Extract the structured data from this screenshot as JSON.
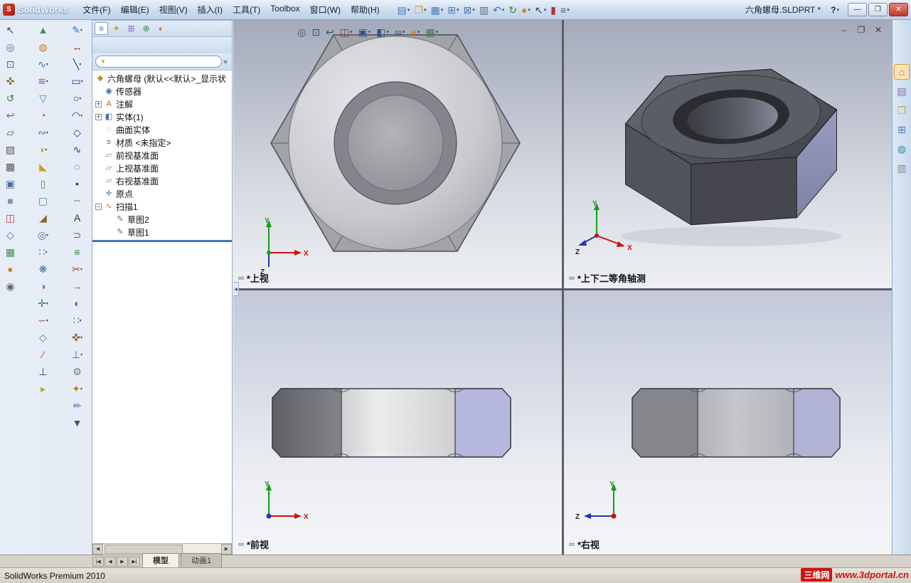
{
  "window": {
    "app_name": "SolidWorks",
    "doc_title": "六角螺母.SLDPRT *",
    "help_label": "?",
    "controls": {
      "minimize": "—",
      "maximize": "❐",
      "close": "✕"
    },
    "doc_controls": {
      "minimize": "–",
      "restore": "❐",
      "close": "✕"
    }
  },
  "menubar": {
    "items": [
      {
        "name": "menu-file",
        "label": "文件(F)"
      },
      {
        "name": "menu-edit",
        "label": "编辑(E)"
      },
      {
        "name": "menu-view",
        "label": "视图(V)"
      },
      {
        "name": "menu-insert",
        "label": "插入(I)"
      },
      {
        "name": "menu-tools",
        "label": "工具(T)"
      },
      {
        "name": "menu-toolbox",
        "label": "Toolbox"
      },
      {
        "name": "menu-window",
        "label": "窗口(W)"
      },
      {
        "name": "menu-help",
        "label": "帮助(H)"
      }
    ]
  },
  "titlebar_tools": [
    {
      "name": "new-file-icon",
      "glyph": "▤",
      "color": "#4a78b8",
      "caret": true
    },
    {
      "name": "open-file-icon",
      "glyph": "❐",
      "color": "#c9a232",
      "caret": true
    },
    {
      "name": "save-icon",
      "glyph": "▦",
      "color": "#4a78b8",
      "caret": true
    },
    {
      "name": "make-drawing-icon",
      "glyph": "⊞",
      "color": "#4a78b8",
      "caret": true
    },
    {
      "name": "make-assembly-icon",
      "glyph": "⊠",
      "color": "#4a78b8",
      "caret": true
    },
    {
      "name": "print-icon",
      "glyph": "▥",
      "color": "#5a6a7a",
      "caret": false
    },
    {
      "name": "undo-icon",
      "glyph": "↶",
      "color": "#3a6fc4",
      "caret": true
    },
    {
      "name": "rebuild-icon",
      "glyph": "↻",
      "color": "#3a8a3a",
      "caret": false
    },
    {
      "name": "edit-appearance-icon",
      "glyph": "●",
      "color": "#cc8833",
      "caret": true
    },
    {
      "name": "select-cursor-icon",
      "glyph": "↖",
      "color": "#39414f",
      "caret": true
    },
    {
      "name": "toolbox-icon",
      "glyph": "▮",
      "color": "#b03030",
      "caret": false
    },
    {
      "name": "command-manager-icon",
      "glyph": "≡",
      "color": "#44608a",
      "caret": true
    }
  ],
  "headsup_tools": [
    {
      "name": "zoom-fit-icon",
      "glyph": "◎",
      "color": "#33527d",
      "caret": false
    },
    {
      "name": "zoom-area-icon",
      "glyph": "⊡",
      "color": "#33527d",
      "caret": false
    },
    {
      "name": "previous-view-icon",
      "glyph": "↩",
      "color": "#33527d",
      "caret": false
    },
    {
      "name": "section-view-icon",
      "glyph": "◫",
      "color": "#7a3a3a",
      "caret": true
    },
    {
      "name": "view-orientation-icon",
      "glyph": "▣",
      "color": "#33527d",
      "caret": true
    },
    {
      "name": "display-style-icon",
      "glyph": "◧",
      "color": "#33527d",
      "caret": true
    },
    {
      "name": "hide-show-items-icon",
      "glyph": "∞",
      "color": "#33527d",
      "caret": true
    },
    {
      "name": "edit-appearance-icon",
      "glyph": "●",
      "color": "#cc8833",
      "caret": true
    },
    {
      "name": "apply-scene-icon",
      "glyph": "▦",
      "color": "#3a7a4a",
      "caret": true
    }
  ],
  "left_toolbar_view": [
    {
      "name": "select-icon",
      "glyph": "↖",
      "color": "#39414f",
      "caret": false
    },
    {
      "name": "zoom-fit-icon",
      "glyph": "◎",
      "color": "#4a6fa0",
      "caret": false
    },
    {
      "name": "zoom-area-icon",
      "glyph": "⊡",
      "color": "#4a6fa0",
      "caret": false
    },
    {
      "name": "pan-icon",
      "glyph": "✜",
      "color": "#8a6a2a",
      "caret": false
    },
    {
      "name": "rotate-view-icon",
      "glyph": "↺",
      "color": "#3a7a3a",
      "caret": false
    },
    {
      "name": "previous-view-icon",
      "glyph": "↩",
      "color": "#4a6fa0",
      "caret": false
    },
    {
      "name": "wireframe-icon",
      "glyph": "▱",
      "color": "#5a5a62",
      "caret": false
    },
    {
      "name": "hidden-lines-visible-icon",
      "glyph": "▨",
      "color": "#5a5a62",
      "caret": false
    },
    {
      "name": "hidden-lines-removed-icon",
      "glyph": "▩",
      "color": "#5a5a62",
      "caret": false
    },
    {
      "name": "shaded-with-edges-icon",
      "glyph": "▣",
      "color": "#4a6fa0",
      "caret": false
    },
    {
      "name": "shaded-icon",
      "glyph": "■",
      "color": "#7d93b8",
      "caret": false
    },
    {
      "name": "section-view-icon",
      "glyph": "◫",
      "color": "#a04a4a",
      "caret": false
    },
    {
      "name": "view-orientation-icon",
      "glyph": "◇",
      "color": "#4a6fa0",
      "caret": false
    },
    {
      "name": "apply-scene-icon",
      "glyph": "▦",
      "color": "#4a8a4a",
      "caret": false
    },
    {
      "name": "edit-appearance-icon",
      "glyph": "●",
      "color": "#d08030",
      "caret": false
    },
    {
      "name": "camera-views-icon",
      "glyph": "◉",
      "color": "#666666",
      "caret": false
    }
  ],
  "left_toolbar_features": [
    {
      "name": "extruded-boss-icon",
      "glyph": "▲",
      "color": "#3f8f3f",
      "caret": false
    },
    {
      "name": "revolved-boss-icon",
      "glyph": "◍",
      "color": "#cc7a22",
      "caret": false
    },
    {
      "name": "swept-boss-icon",
      "glyph": "∿",
      "color": "#3a6fc0",
      "caret": true
    },
    {
      "name": "lofted-boss-icon",
      "glyph": "≋",
      "color": "#7a4ac0",
      "caret": true
    },
    {
      "name": "extruded-cut-icon",
      "glyph": "▽",
      "color": "#3f8fa0",
      "caret": false
    },
    {
      "name": "revolved-cut-icon",
      "glyph": "◔",
      "color": "#c05a2a",
      "caret": false
    },
    {
      "name": "swept-cut-icon",
      "glyph": "∾",
      "color": "#5a6a9a",
      "caret": true
    },
    {
      "name": "fillet-icon",
      "glyph": "◖",
      "color": "#d0a020",
      "caret": true
    },
    {
      "name": "chamfer-icon",
      "glyph": "◣",
      "color": "#d0a020",
      "caret": false
    },
    {
      "name": "rib-icon",
      "glyph": "▯",
      "color": "#6a8a4a",
      "caret": false
    },
    {
      "name": "shell-icon",
      "glyph": "▢",
      "color": "#4a8a8a",
      "caret": false
    },
    {
      "name": "draft-icon",
      "glyph": "◢",
      "color": "#8a6a3a",
      "caret": false
    },
    {
      "name": "hole-wizard-icon",
      "glyph": "◎",
      "color": "#4a6fa0",
      "caret": true
    },
    {
      "name": "linear-pattern-icon",
      "glyph": "∷",
      "color": "#3f6f9f",
      "caret": true
    },
    {
      "name": "circular-pattern-icon",
      "glyph": "❋",
      "color": "#3f6f9f",
      "caret": false
    },
    {
      "name": "mirror-icon",
      "glyph": "◑",
      "color": "#6f6fae",
      "caret": false
    },
    {
      "name": "reference-geometry-icon",
      "glyph": "✛",
      "color": "#2f7f5f",
      "caret": true
    },
    {
      "name": "curves-icon",
      "glyph": "∽",
      "color": "#9f4f7f",
      "caret": true
    },
    {
      "name": "plane-icon",
      "glyph": "◇",
      "color": "#5a7aa0",
      "caret": false
    },
    {
      "name": "axis-icon",
      "glyph": "⁄",
      "color": "#cc3333",
      "caret": false
    },
    {
      "name": "coordinate-system-icon",
      "glyph": "⊥",
      "color": "#3a3a8a",
      "caret": false
    },
    {
      "name": "instant3d-icon",
      "glyph": "▸",
      "color": "#caa020",
      "caret": false
    }
  ],
  "left_toolbar_sketch": [
    {
      "name": "sketch-icon",
      "glyph": "✎",
      "color": "#3a6fc0",
      "caret": true
    },
    {
      "name": "smart-dimension-icon",
      "glyph": "↔",
      "color": "#8a2a2a",
      "caret": false
    },
    {
      "name": "line-icon",
      "glyph": "╲",
      "color": "#2a2a8a",
      "caret": true
    },
    {
      "name": "rectangle-icon",
      "glyph": "▭",
      "color": "#2a2a8a",
      "caret": true
    },
    {
      "name": "circle-icon",
      "glyph": "○",
      "color": "#2a2a8a",
      "caret": true
    },
    {
      "name": "arc-icon",
      "glyph": "◠",
      "color": "#2a2a8a",
      "caret": true
    },
    {
      "name": "polygon-icon",
      "glyph": "◇",
      "color": "#2a2a8a",
      "caret": false
    },
    {
      "name": "spline-icon",
      "glyph": "∿",
      "color": "#2a2a8a",
      "caret": false
    },
    {
      "name": "ellipse-icon",
      "glyph": "◌",
      "color": "#2a2a8a",
      "caret": false
    },
    {
      "name": "point-icon",
      "glyph": "•",
      "color": "#2a2a8a",
      "caret": false
    },
    {
      "name": "centerline-icon",
      "glyph": "┄",
      "color": "#555577",
      "caret": false
    },
    {
      "name": "text-icon",
      "glyph": "A",
      "color": "#333333",
      "caret": false
    },
    {
      "name": "convert-entities-icon",
      "glyph": "⊃",
      "color": "#3a7a3a",
      "caret": false
    },
    {
      "name": "offset-entities-icon",
      "glyph": "≡",
      "color": "#3a7a3a",
      "caret": false
    },
    {
      "name": "trim-entities-icon",
      "glyph": "✂",
      "color": "#8a4a2a",
      "caret": true
    },
    {
      "name": "extend-entities-icon",
      "glyph": "→",
      "color": "#8a4a2a",
      "caret": false
    },
    {
      "name": "mirror-entities-icon",
      "glyph": "◐",
      "color": "#5a5aa0",
      "caret": false
    },
    {
      "name": "linear-sketch-pattern-icon",
      "glyph": "∷",
      "color": "#3f6f9f",
      "caret": true
    },
    {
      "name": "move-entities-icon",
      "glyph": "✜",
      "color": "#7a5a2a",
      "caret": true
    },
    {
      "name": "display-relations-icon",
      "glyph": "⊥",
      "color": "#3a6fa0",
      "caret": true
    },
    {
      "name": "repair-sketch-icon",
      "glyph": "⚙",
      "color": "#777777",
      "caret": false
    },
    {
      "name": "quick-snaps-icon",
      "glyph": "✦",
      "color": "#b08020",
      "caret": true
    },
    {
      "name": "rapid-sketch-icon",
      "glyph": "✏",
      "color": "#4a6fa0",
      "caret": false
    },
    {
      "name": "toolbar-overflow-icon",
      "glyph": "▼",
      "color": "#445566",
      "caret": false
    }
  ],
  "feature_panel": {
    "tabs": [
      {
        "name": "featuremanager-tab-icon",
        "glyph": "≡",
        "color": "#3a6fc0",
        "active": true
      },
      {
        "name": "propertymanager-tab-icon",
        "glyph": "✦",
        "color": "#caa020",
        "active": false
      },
      {
        "name": "configurationmanager-tab-icon",
        "glyph": "⊞",
        "color": "#8a6ab0",
        "active": false
      },
      {
        "name": "dimxpertmanager-tab-icon",
        "glyph": "⊕",
        "color": "#3a8a5a",
        "active": false
      },
      {
        "name": "displaymanager-tab-icon",
        "glyph": "◐",
        "color": "#b06a3a",
        "active": false
      }
    ],
    "overflow_label": "»",
    "filter_glyph": "▼",
    "root": {
      "glyph": "◆",
      "label": "六角螺母 (默认<<默认>_显示状"
    },
    "tree": [
      {
        "name": "tree-item-sensors",
        "glyph": "◉",
        "color": "#3a6fa0",
        "label": "传感器",
        "expand": ""
      },
      {
        "name": "tree-item-annotations",
        "glyph": "A",
        "color": "#b06a2a",
        "label": "注解",
        "expand": "+"
      },
      {
        "name": "tree-item-solid-bodies",
        "glyph": "◧",
        "color": "#3a6fc0",
        "label": "实体(1)",
        "expand": "+"
      },
      {
        "name": "tree-item-surface-bodies",
        "glyph": "◌",
        "color": "#3a8a8a",
        "label": "曲面实体",
        "expand": ""
      },
      {
        "name": "tree-item-material",
        "glyph": "≡",
        "color": "#666677",
        "label": "材质 <未指定>",
        "expand": ""
      },
      {
        "name": "tree-item-front-plane",
        "glyph": "▱",
        "color": "#7a8aa0",
        "label": "前视基准面",
        "expand": ""
      },
      {
        "name": "tree-item-top-plane",
        "glyph": "▱",
        "color": "#7a8aa0",
        "label": "上视基准面",
        "expand": ""
      },
      {
        "name": "tree-item-right-plane",
        "glyph": "▱",
        "color": "#7a8aa0",
        "label": "右视基准面",
        "expand": ""
      },
      {
        "name": "tree-item-origin",
        "glyph": "✛",
        "color": "#3a6fa0",
        "label": "原点",
        "expand": ""
      },
      {
        "name": "tree-item-sweep1",
        "glyph": "∿",
        "color": "#cc7a22",
        "label": "扫描1",
        "expand": "−"
      },
      {
        "name": "tree-item-sketch2",
        "glyph": "✎",
        "color": "#4a6fa0",
        "label": "草图2",
        "expand": "",
        "indent": 1
      },
      {
        "name": "tree-item-sketch1",
        "glyph": "✎",
        "color": "#4a6fa0",
        "label": "草图1",
        "expand": "",
        "indent": 1
      }
    ]
  },
  "viewports": {
    "eye_glyph": "∞",
    "top_left": {
      "label": "*上视"
    },
    "top_right": {
      "label": "*上下二等角轴测"
    },
    "bottom_left": {
      "label": "*前视"
    },
    "bottom_right": {
      "label": "*右视"
    }
  },
  "graphics": {
    "collapse_glyph": "◀"
  },
  "task_pane": [
    {
      "name": "solidworks-resources-icon",
      "glyph": "⌂",
      "color": "#cc6a2a",
      "active": true
    },
    {
      "name": "design-library-icon",
      "glyph": "▤",
      "color": "#8a6ab0",
      "active": false
    },
    {
      "name": "file-explorer-icon",
      "glyph": "❐",
      "color": "#caa030",
      "active": false
    },
    {
      "name": "view-palette-icon",
      "glyph": "⊞",
      "color": "#4a78b8",
      "active": false
    },
    {
      "name": "appearances-scenes-icon",
      "glyph": "◍",
      "color": "#3a8aa0",
      "active": false
    },
    {
      "name": "custom-properties-icon",
      "glyph": "▥",
      "color": "#888888",
      "active": false
    }
  ],
  "bottom": {
    "tab_nav": [
      {
        "name": "first-tab-button",
        "glyph": "|◀"
      },
      {
        "name": "prev-tab-button",
        "glyph": "◀"
      },
      {
        "name": "next-tab-button",
        "glyph": "▶"
      },
      {
        "name": "last-tab-button",
        "glyph": "▶|"
      }
    ],
    "tabs": [
      {
        "name": "tab-model",
        "label": "模型",
        "active": true
      },
      {
        "name": "tab-animation1",
        "label": "动画1",
        "active": false
      }
    ],
    "hscroll": {
      "left": "◀",
      "right": "▶"
    },
    "status_text": "SolidWorks Premium 2010",
    "watermark": {
      "site_name": "三维网",
      "site_url": "www.3dportal.cn"
    }
  },
  "colors": {
    "viewport_top": "#a4aabb",
    "viewport_bottom": "#eef0f3",
    "nut_dark": "#4a4c55",
    "nut_light": "#d6d7da",
    "nut_accent_lavender": "#b5b8dc",
    "axis_x": "#cc1111",
    "axis_y": "#12a012",
    "axis_z": "#2233bb"
  }
}
